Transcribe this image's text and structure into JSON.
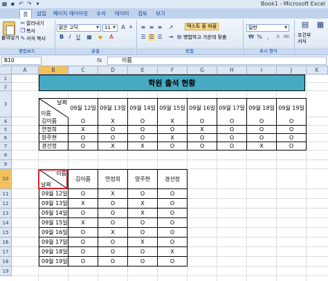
{
  "window": {
    "title": "Book1 - Microsoft Excel"
  },
  "quick_access": {
    "icons": [
      "excel-logo-icon",
      "save-icon",
      "undo-icon",
      "redo-icon",
      "customize-icon"
    ]
  },
  "tabs": [
    "홈",
    "삽입",
    "페이지 레이아웃",
    "수식",
    "데이터",
    "검토",
    "보기"
  ],
  "ribbon": {
    "clipboard": {
      "paste": "붙여넣기",
      "cut": "잘라내기",
      "copy": "복사",
      "format_painter": "서식 복사",
      "label": "클립보드"
    },
    "font": {
      "name": "맑은 고딕",
      "size": "11",
      "label": "글꼴"
    },
    "alignment": {
      "wrap": "텍스트 줄 바꿈",
      "merge": "병합하고 가운데 맞춤",
      "label": "맞춤"
    },
    "number": {
      "format": "일반",
      "label": "표시 형식"
    },
    "styles": {
      "conditional": "조건부",
      "conditional2": "서식"
    }
  },
  "formula_bar": {
    "name_box": "B10",
    "fx": "fx",
    "value": "이름"
  },
  "columns": [
    "A",
    "B",
    "C",
    "D",
    "E",
    "F",
    "G",
    "H",
    "I",
    "J",
    "K"
  ],
  "rows": [
    "1",
    "2",
    "3",
    "4",
    "5",
    "6",
    "7",
    "8",
    "9",
    "10",
    "11",
    "12",
    "13",
    "14",
    "15",
    "16",
    "17",
    "18",
    "19"
  ],
  "sheet": {
    "title": "학원 출석 현황",
    "dates": [
      "09월 12일",
      "09월 13일",
      "09월 14일",
      "09월 15일",
      "09월 16일",
      "09월 17일",
      "09월 18일",
      "09월 19일"
    ],
    "names": [
      "김이름",
      "연정희",
      "양주현",
      "경선정"
    ],
    "diag_top1": "날짜",
    "diag_bot1": "이름",
    "diag_top2": "이름",
    "diag_bot2": "날짜",
    "attendance": [
      [
        "O",
        "X",
        "O",
        "X",
        "O",
        "O",
        "O",
        "O"
      ],
      [
        "X",
        "O",
        "O",
        "O",
        "X",
        "O",
        "O",
        "O"
      ],
      [
        "O",
        "O",
        "O",
        "X",
        "O",
        "O",
        "O",
        "O"
      ],
      [
        "O",
        "X",
        "X",
        "O",
        "O",
        "O",
        "X",
        "O"
      ]
    ],
    "attendance_t": [
      [
        "O",
        "X",
        "O",
        "O"
      ],
      [
        "X",
        "O",
        "X",
        "O"
      ],
      [
        "O",
        "O",
        "X",
        "O"
      ],
      [
        "X",
        "O",
        "O",
        "O"
      ],
      [
        "O",
        "X",
        "O",
        "O"
      ],
      [
        "O",
        "O",
        "X",
        "O"
      ],
      [
        "O",
        "O",
        "O",
        "X"
      ],
      [
        "O",
        "O",
        "O",
        "O"
      ]
    ]
  }
}
